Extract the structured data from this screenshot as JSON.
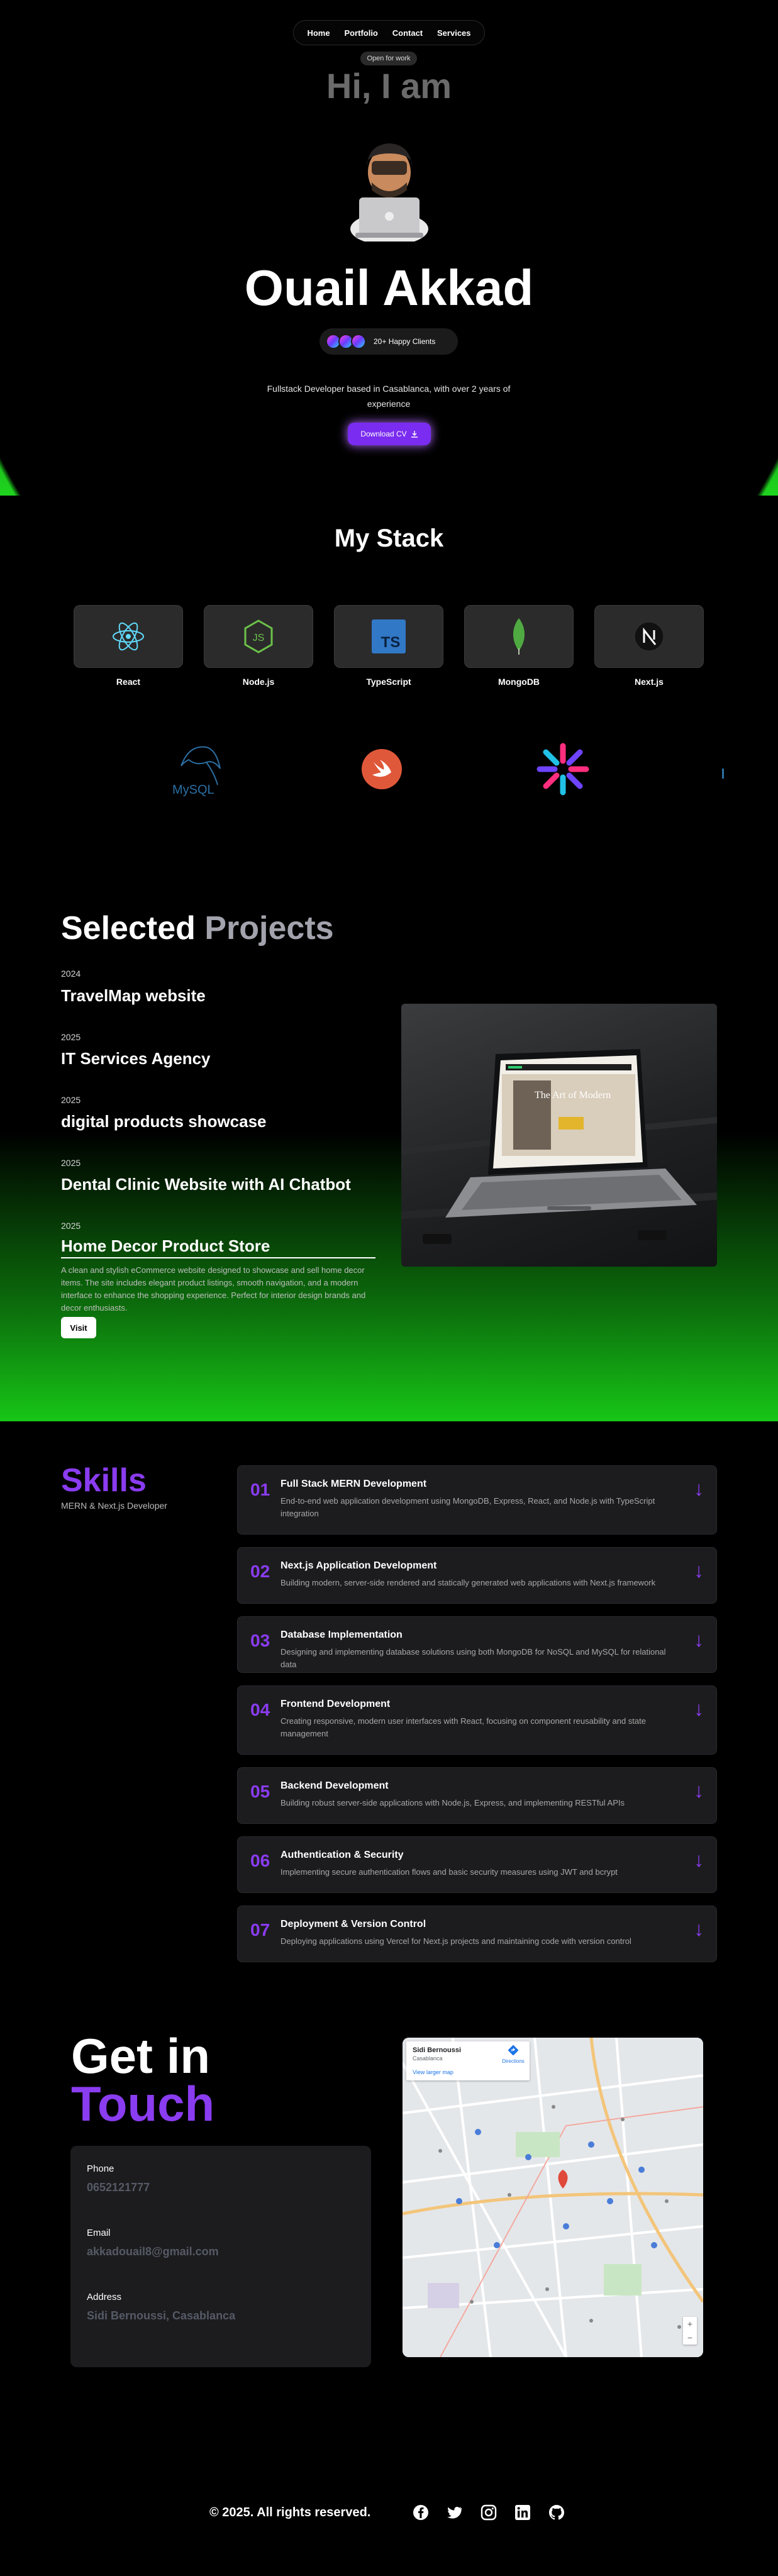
{
  "nav": {
    "items": [
      "Home",
      "Portfolio",
      "Contact",
      "Services"
    ]
  },
  "hero": {
    "status_badge": "Open for work",
    "greeting": "Hi, I am",
    "name": "Ouail Akkad",
    "clients_label": "20+ Happy Clients",
    "description": "Fullstack Developer based in Casablanca, with over 2 years of experience",
    "cv_button": "Download CV",
    "accent": "#7a2cf0",
    "glow": "#1fd41f"
  },
  "stack": {
    "title": "My Stack",
    "tiles": [
      {
        "label": "React",
        "icon": "react-icon"
      },
      {
        "label": "Node.js",
        "icon": "nodejs-icon"
      },
      {
        "label": "TypeScript",
        "icon": "typescript-icon"
      },
      {
        "label": "MongoDB",
        "icon": "mongodb-icon"
      },
      {
        "label": "Next.js",
        "icon": "nextjs-icon"
      }
    ],
    "extra_logos": [
      {
        "icon": "mysql-icon",
        "text": "MySQL"
      },
      {
        "icon": "swift-icon"
      },
      {
        "icon": "starburst-icon"
      }
    ]
  },
  "projects": {
    "title_a": "Selected",
    "title_b": "Projects",
    "items": [
      {
        "year": "2024",
        "name": "TravelMap website"
      },
      {
        "year": "2025",
        "name": "IT Services Agency"
      },
      {
        "year": "2025",
        "name": "digital products showcase"
      },
      {
        "year": "2025",
        "name": "Dental Clinic Website with AI Chatbot"
      },
      {
        "year": "2025",
        "name": "Home Decor Product Store"
      }
    ],
    "selected_description": "A clean and stylish eCommerce website designed to showcase and sell home decor items. The site includes elegant product listings, smooth navigation, and a modern interface to enhance the shopping experience. Perfect for interior design brands and decor enthusiasts.",
    "visit_label": "Visit",
    "preview_heading": "The Art of Modern"
  },
  "skills": {
    "title": "Skills",
    "subtitle": "MERN & Next.js Developer",
    "items": [
      {
        "num": "01",
        "title": "Full Stack MERN Development",
        "desc": "End-to-end web application development using MongoDB, Express, React, and Node.js with TypeScript integration"
      },
      {
        "num": "02",
        "title": "Next.js Application Development",
        "desc": "Building modern, server-side rendered and statically generated web applications with Next.js framework"
      },
      {
        "num": "03",
        "title": "Database Implementation",
        "desc": "Designing and implementing database solutions using both MongoDB for NoSQL and MySQL for relational data"
      },
      {
        "num": "04",
        "title": "Frontend Development",
        "desc": "Creating responsive, modern user interfaces with React, focusing on component reusability and state management"
      },
      {
        "num": "05",
        "title": "Backend Development",
        "desc": "Building robust server-side applications with Node.js, Express, and implementing RESTful APIs"
      },
      {
        "num": "06",
        "title": "Authentication & Security",
        "desc": "Implementing secure authentication flows and basic security measures using JWT and bcrypt"
      },
      {
        "num": "07",
        "title": "Deployment & Version Control",
        "desc": "Deploying applications using Vercel for Next.js projects and maintaining code with version control"
      }
    ]
  },
  "contact": {
    "title_a": "Get in",
    "title_b": "Touch",
    "phone_label": "Phone",
    "phone": "0652121777",
    "email_label": "Email",
    "email": "akkadouail8@gmail.com",
    "address_label": "Address",
    "address": "Sidi Bernoussi, Casablanca",
    "map": {
      "place_name": "Sidi Bernoussi",
      "place_sub": "Casablanca",
      "directions_label": "Directions",
      "larger_map_label": "View larger map",
      "zoom_in": "+",
      "zoom_out": "−"
    }
  },
  "footer": {
    "copyright": "© 2025. All rights reserved.",
    "socials": [
      "facebook-icon",
      "twitter-icon",
      "instagram-icon",
      "linkedin-icon",
      "github-icon"
    ]
  }
}
